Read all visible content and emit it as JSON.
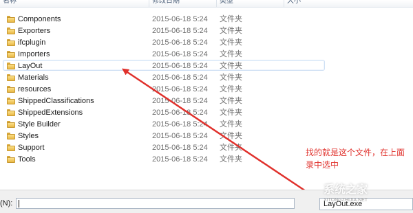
{
  "columns": {
    "name": "名称",
    "date": "修改日期",
    "type": "类型",
    "size": "大小"
  },
  "rows": [
    {
      "name": "Components",
      "date": "2015-06-18 5:24",
      "type": "文件夹"
    },
    {
      "name": "Exporters",
      "date": "2015-06-18 5:24",
      "type": "文件夹"
    },
    {
      "name": "ifcplugin",
      "date": "2015-06-18 5:24",
      "type": "文件夹"
    },
    {
      "name": "Importers",
      "date": "2015-06-18 5:24",
      "type": "文件夹"
    },
    {
      "name": "LayOut",
      "date": "2015-06-18 5:24",
      "type": "文件夹",
      "selected": true
    },
    {
      "name": "Materials",
      "date": "2015-06-18 5:24",
      "type": "文件夹"
    },
    {
      "name": "resources",
      "date": "2015-06-18 5:24",
      "type": "文件夹"
    },
    {
      "name": "ShippedClassifications",
      "date": "2015-06-18 5:24",
      "type": "文件夹"
    },
    {
      "name": "ShippedExtensions",
      "date": "2015-06-18 5:24",
      "type": "文件夹"
    },
    {
      "name": "Style Builder",
      "date": "2015-06-18 5:24",
      "type": "文件夹"
    },
    {
      "name": "Styles",
      "date": "2015-06-18 5:24",
      "type": "文件夹"
    },
    {
      "name": "Support",
      "date": "2015-06-18 5:24",
      "type": "文件夹"
    },
    {
      "name": "Tools",
      "date": "2015-06-18 5:24",
      "type": "文件夹"
    }
  ],
  "annotation": {
    "line1": "找的就是这个文件，在上面",
    "line2": "录中选中"
  },
  "footer": {
    "filename_label": "(N):",
    "filename_value": "",
    "filetype_value": "LayOut.exe"
  },
  "watermark": {
    "text": "系统之家",
    "url": "XITONGZHIJIA.NET"
  },
  "colors": {
    "arrow": "#e0312c",
    "annotation": "#e0312c",
    "selection_border": "#cfe0f4"
  },
  "icons": {
    "folder": "folder-icon",
    "arrow": "red-arrow-annotation"
  }
}
